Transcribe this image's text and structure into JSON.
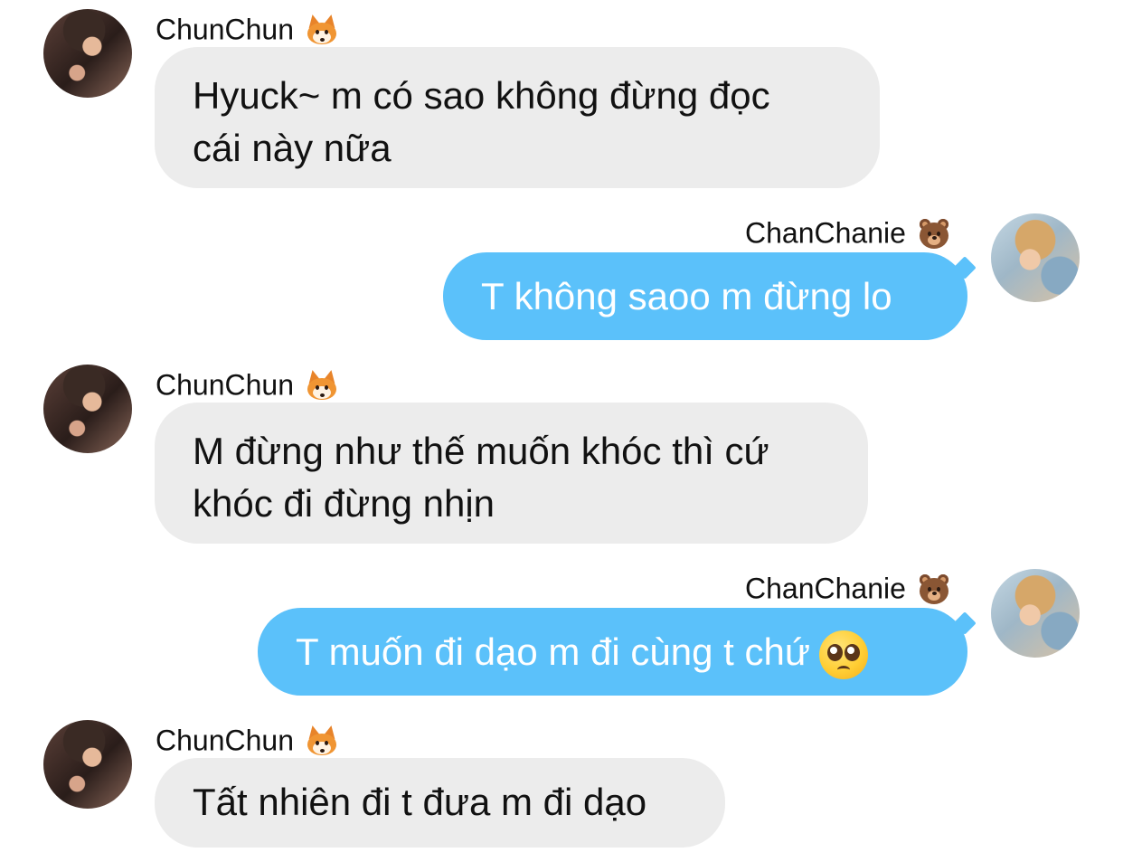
{
  "contacts": {
    "friend": {
      "name": "ChunChun",
      "emoji": "fox-emoji"
    },
    "me": {
      "name": "ChanChanie",
      "emoji": "bear-emoji"
    }
  },
  "messages": [
    {
      "sender": "ChunChun",
      "direction": "incoming",
      "lines": [
        "Hyuck~ m có sao không đừng đọc",
        "cái này nữa"
      ]
    },
    {
      "sender": "ChanChanie",
      "direction": "outgoing",
      "lines": [
        "T không saoo m đừng lo"
      ]
    },
    {
      "sender": "ChunChun",
      "direction": "incoming",
      "lines": [
        "M đừng như thế muốn khóc thì cứ",
        "khóc đi đừng nhịn"
      ]
    },
    {
      "sender": "ChanChanie",
      "direction": "outgoing",
      "lines": [
        "T muốn đi dạo m đi cùng t chứ"
      ],
      "trailing_emoji": "pleading-face-emoji"
    },
    {
      "sender": "ChunChun",
      "direction": "incoming",
      "lines": [
        "Tất nhiên đi t đưa m đi dạo"
      ]
    }
  ],
  "colors": {
    "incoming_bubble": "#ececec",
    "outgoing_bubble": "#5bc1fa",
    "incoming_text": "#111111",
    "outgoing_text": "#ffffff",
    "background": "#ffffff"
  }
}
